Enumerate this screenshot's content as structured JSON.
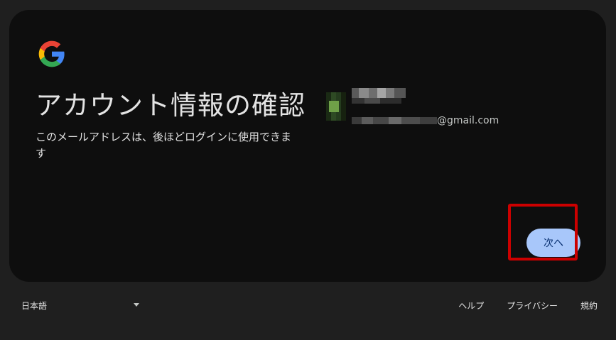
{
  "card": {
    "title": "アカウント情報の確認",
    "subtitle": "このメールアドレスは、後ほどログインに使用できます",
    "account": {
      "email_domain": "@gmail.com"
    },
    "next_button": "次へ"
  },
  "footer": {
    "language": "日本語",
    "links": [
      "ヘルプ",
      "プライバシー",
      "規約"
    ]
  },
  "colors": {
    "page_bg": "#1f1f1f",
    "card_bg": "#0e0e0e",
    "primary_button": "#a8c7fa",
    "highlight": "#cc0000"
  }
}
